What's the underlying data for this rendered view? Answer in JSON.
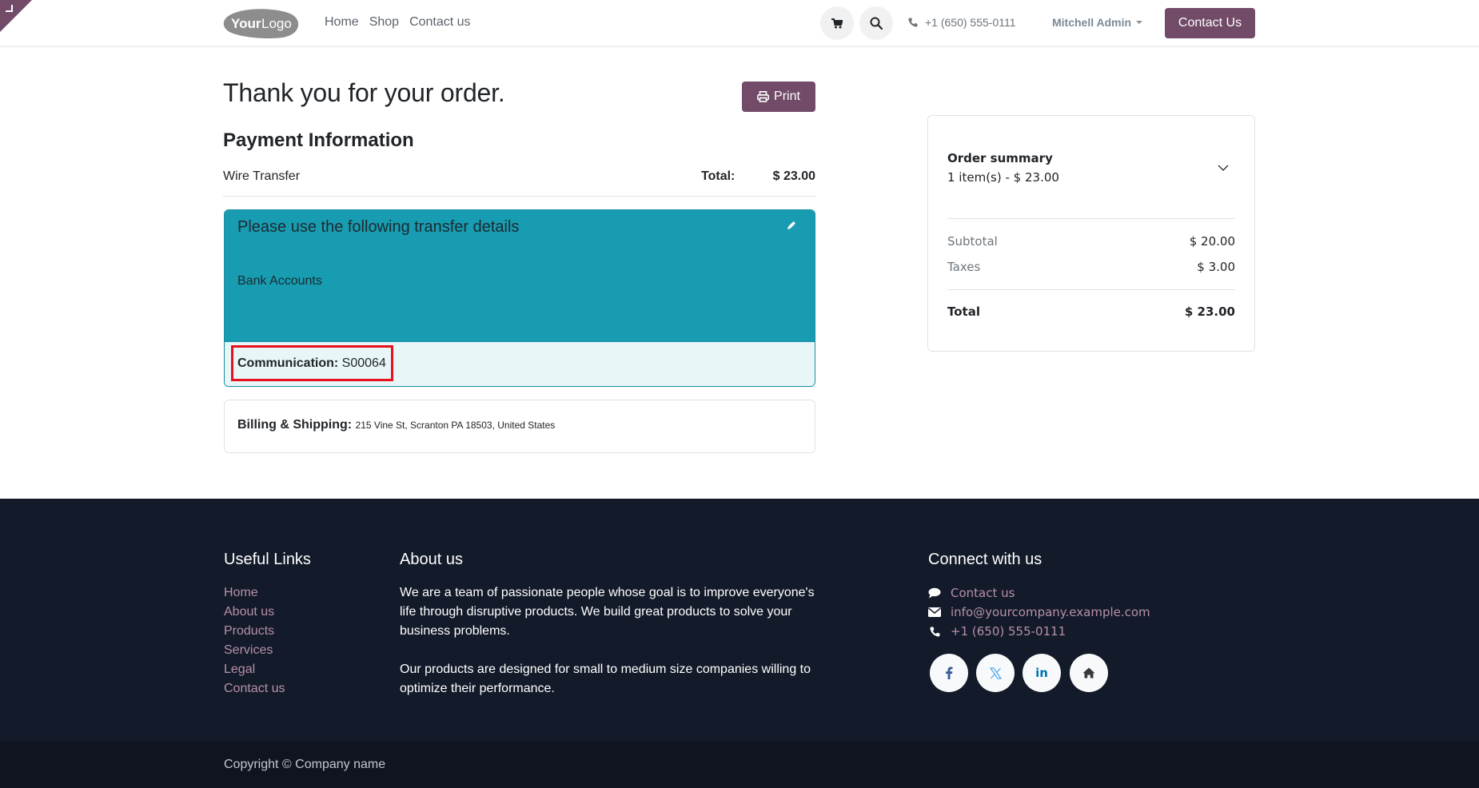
{
  "header": {
    "logo_text_bold": "Your",
    "logo_text_light": "Logo",
    "nav": [
      "Home",
      "Shop",
      "Contact us"
    ],
    "phone": "+1 (650) 555-0111",
    "user": "Mitchell Admin",
    "contact_button": "Contact Us",
    "icons": {
      "cart": "cart-icon",
      "search": "search-icon",
      "phone": "phone-icon"
    }
  },
  "main": {
    "title": "Thank you for your order.",
    "print_button": "Print",
    "payment_title": "Payment Information",
    "payment_method": "Wire Transfer",
    "total_label": "Total:",
    "total_value": "$ 23.00",
    "transfer": {
      "title": "Please use the following transfer details",
      "bank_label": "Bank Accounts",
      "communication_label": "Communication:",
      "communication_value": "S00064"
    },
    "billing": {
      "label": "Billing & Shipping:",
      "address": "215 Vine St, Scranton PA 18503, United States"
    }
  },
  "summary": {
    "title": "Order summary",
    "subtitle": "1 item(s) -  $ 23.00",
    "rows": [
      {
        "label": "Subtotal",
        "value": "$ 20.00"
      },
      {
        "label": "Taxes",
        "value": "$ 3.00"
      }
    ],
    "total": {
      "label": "Total",
      "value": "$ 23.00"
    }
  },
  "footer": {
    "useful_links_title": "Useful Links",
    "useful_links": [
      "Home",
      "About us",
      "Products",
      "Services",
      "Legal",
      "Contact us"
    ],
    "about_title": "About us",
    "about_paragraphs": [
      "We are a team of passionate people whose goal is to improve everyone's life through disruptive products. We build great products to solve your business problems.",
      "Our products are designed for small to medium size companies willing to optimize their performance."
    ],
    "connect_title": "Connect with us",
    "connect": [
      {
        "icon": "chat-icon",
        "label": "Contact us"
      },
      {
        "icon": "envelope-icon",
        "label": "info@yourcompany.example.com"
      },
      {
        "icon": "phone-icon",
        "label": "+1 (650) 555-0111"
      }
    ],
    "social": [
      "facebook-icon",
      "x-twitter-icon",
      "linkedin-icon",
      "home-icon"
    ],
    "copyright": "Copyright © Company name"
  },
  "colors": {
    "brand": "#714B67",
    "info": "#179CB1",
    "info_light": "#E8F6F8",
    "footer_bg": "#131A29",
    "footer_link": "#B790AE",
    "annotation_red": "#E8101A"
  }
}
